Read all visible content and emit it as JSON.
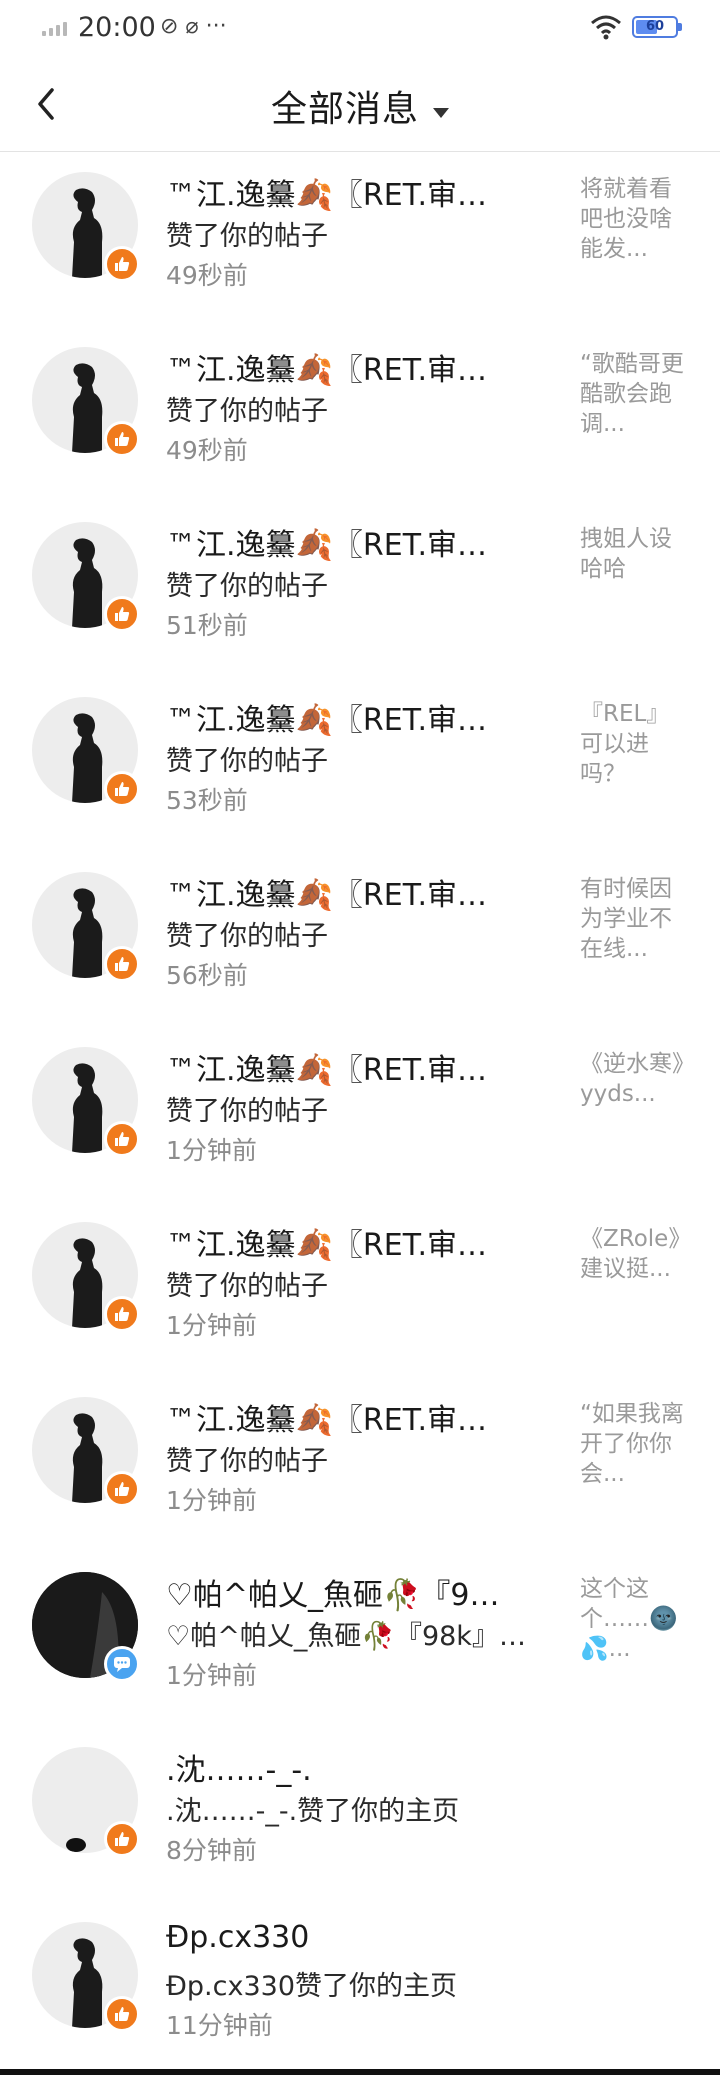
{
  "status_bar": {
    "time": "20:00",
    "extra_icons": "⊘ ⌀ ···",
    "battery": "60"
  },
  "header": {
    "title": "全部消息"
  },
  "notifications": [
    {
      "name": "™江.逸䵵🍂〖RET.审…",
      "action": "赞了你的帖子",
      "time": "49秒前",
      "preview": "将就着看吧也没啥能发...",
      "badge": "like"
    },
    {
      "name": "™江.逸䵵🍂〖RET.审…",
      "action": "赞了你的帖子",
      "time": "49秒前",
      "preview": "“歌酷哥更酷歌会跑调...",
      "badge": "like"
    },
    {
      "name": "™江.逸䵵🍂〖RET.审…",
      "action": "赞了你的帖子",
      "time": "51秒前",
      "preview": "拽姐人设哈哈",
      "badge": "like"
    },
    {
      "name": "™江.逸䵵🍂〖RET.审…",
      "action": "赞了你的帖子",
      "time": "53秒前",
      "preview": "『REL』可以进吗？",
      "badge": "like"
    },
    {
      "name": "™江.逸䵵🍂〖RET.审…",
      "action": "赞了你的帖子",
      "time": "56秒前",
      "preview": "有时候因为学业不在线...",
      "badge": "like"
    },
    {
      "name": "™江.逸䵵🍂〖RET.审…",
      "action": "赞了你的帖子",
      "time": "1分钟前",
      "preview": "《逆水寒》yyds...",
      "badge": "like"
    },
    {
      "name": "™江.逸䵵🍂〖RET.审…",
      "action": "赞了你的帖子",
      "time": "1分钟前",
      "preview": "《ZRole》建议挺...",
      "badge": "like"
    },
    {
      "name": "™江.逸䵵🍂〖RET.审…",
      "action": "赞了你的帖子",
      "time": "1分钟前",
      "preview": "“如果我离开了你你会...",
      "badge": "like"
    },
    {
      "name": "♡帕^帕乂_魚砸🥀『9…",
      "action": "♡帕^帕乂_魚砸🥀『98k』…",
      "time": "1分钟前",
      "preview": "这个这个……🌚💦...",
      "badge": "comment"
    },
    {
      "name": ".沈……-_-.",
      "action": ".沈……-_-.赞了你的主页",
      "time": "8分钟前",
      "preview": "",
      "badge": "like"
    },
    {
      "name": "Ɖp.cx330",
      "action": "Ɖp.cx330赞了你的主页",
      "time": "11分钟前",
      "preview": "",
      "badge": "like"
    }
  ],
  "colors": {
    "like_badge": "#f07a1c",
    "comment_badge": "#4aa3f0",
    "battery": "#5e8cf0"
  }
}
